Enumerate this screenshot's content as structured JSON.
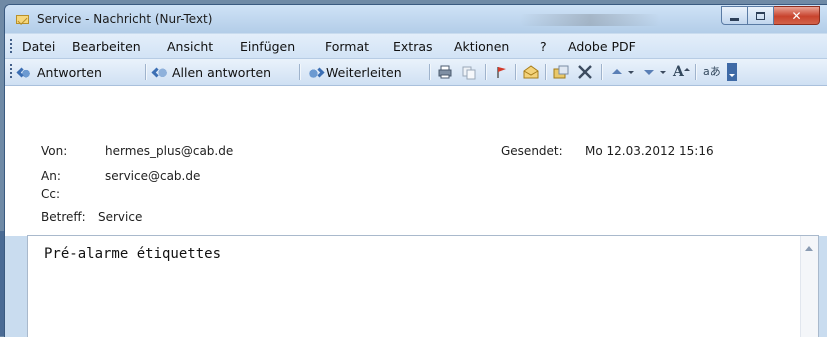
{
  "window": {
    "title": "Service - Nachricht (Nur-Text)",
    "title_icon": "envelope-icon",
    "controls": {
      "minimize": "minimize-icon",
      "maximize": "maximize-icon",
      "close": "✕"
    }
  },
  "menu": [
    "Datei",
    "Bearbeiten",
    "Ansicht",
    "Einfügen",
    "Format",
    "Extras",
    "Aktionen",
    "?",
    "Adobe PDF"
  ],
  "toolbar": {
    "reply": "Antworten",
    "reply_all": "Allen antworten",
    "forward": "Weiterleiten",
    "font_size_glyph": "A",
    "translate_glyph": "aあ"
  },
  "header": {
    "from_label": "Von:",
    "from_value": "hermes_plus@cab.de",
    "sent_label": "Gesendet:",
    "sent_value": "Mo 12.03.2012 15:16",
    "to_label": "An:",
    "to_value": "service@cab.de",
    "cc_label": "Cc:",
    "cc_value": "",
    "subject_label": "Betreff:",
    "subject_value": "Service"
  },
  "body": {
    "text": "Pré-alarme étiquettes"
  },
  "colors": {
    "window_bg": "#c9dcef",
    "close_button": "#c8432d",
    "header_bg": "#ffffff"
  }
}
